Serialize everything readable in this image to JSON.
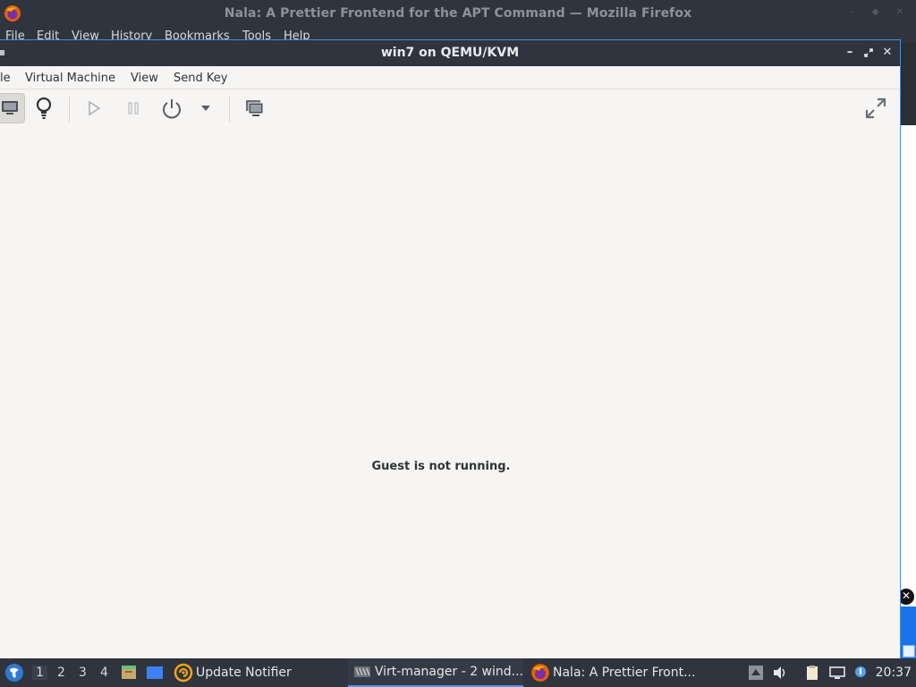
{
  "firefox": {
    "title": "Nala: A Prettier Frontend for the APT Command — Mozilla Firefox",
    "menu": [
      "File",
      "Edit",
      "View",
      "History",
      "Bookmarks",
      "Tools",
      "Help"
    ]
  },
  "vm_window": {
    "title": "win7 on QEMU/KVM",
    "menu": [
      "le",
      "Virtual Machine",
      "View",
      "Send Key"
    ],
    "status_text": "Guest is not running.",
    "toolbar": {
      "console_icon": "monitor-icon",
      "details_icon": "lightbulb-icon",
      "run_icon": "play-icon",
      "pause_icon": "pause-icon",
      "power_icon": "power-icon",
      "power_menu_icon": "dropdown-arrow-icon",
      "snapshots_icon": "snapshots-icon",
      "fullscreen_icon": "fullscreen-icon"
    }
  },
  "taskbar": {
    "workspaces": [
      "1",
      "2",
      "3",
      "4"
    ],
    "active_workspace": "1",
    "tasks": [
      {
        "label": "Update Notifier"
      },
      {
        "label": "Virt-manager - 2 wind..."
      },
      {
        "label": "Nala: A Prettier Front..."
      }
    ],
    "clock": "20:37"
  },
  "colors": {
    "titlebar": "#2f343f",
    "window_bg": "#f6f5f4",
    "accent": "#5294e2"
  }
}
